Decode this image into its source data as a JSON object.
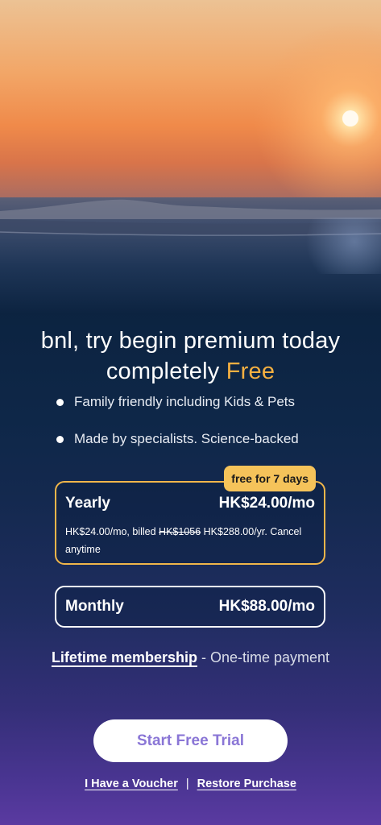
{
  "hero": {
    "image": "sunset-over-sea"
  },
  "headline": {
    "line1": "bnl, try begin premium today",
    "line2_prefix": "completely ",
    "line2_highlight": "Free",
    "highlight_color": "#f5b041"
  },
  "features": [
    {
      "icon": "bullet",
      "text": "Family friendly including Kids & Pets"
    },
    {
      "icon": "bullet",
      "text": "Made by specialists. Science-backed"
    }
  ],
  "plans": {
    "yearly": {
      "badge": "free for 7 days",
      "name": "Yearly",
      "price": "HK$24.00/mo",
      "detail_before": "HK$24.00/mo, billed ",
      "detail_strike": "HK$1056",
      "detail_after": " HK$288.00/yr. Cancel anytime",
      "selected": true,
      "border_color": "#f0b64a"
    },
    "monthly": {
      "name": "Monthly",
      "price": "HK$88.00/mo",
      "selected": false
    }
  },
  "lifetime": {
    "link": "Lifetime membership",
    "suffix": " - One-time payment"
  },
  "cta": {
    "label": "Start Free Trial",
    "text_color": "#8a76d6"
  },
  "footer": {
    "voucher": "I Have a Voucher",
    "separator": "|",
    "restore": "Restore Purchase"
  }
}
